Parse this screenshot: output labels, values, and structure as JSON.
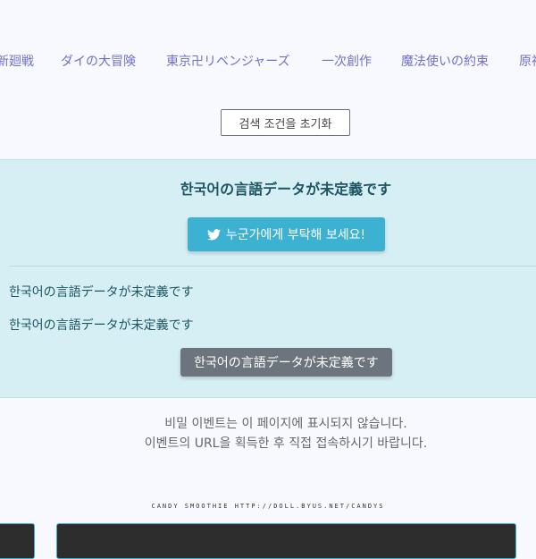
{
  "tags": [
    "新廻戦",
    "ダイの大冒険",
    "東京卍リベンジャーズ",
    "一次創作",
    "魔法使いの約束",
    "原神"
  ],
  "reset_button": {
    "label": "검색 조건을 초기화"
  },
  "alert": {
    "title": "한국어の言語データが未定義です",
    "twitter_button": {
      "icon": "twitter-icon",
      "label": "누군가에게 부탁해 보세요!"
    },
    "lines": [
      "한국어の言語データが未定義です",
      "한국어の言語データが未定義です"
    ],
    "gray_button": {
      "label": "한국어の言語データが未定義です"
    }
  },
  "notice": {
    "line1": "비밀 이벤트는 이 페이지에 표시되지 않습니다.",
    "line2": "이벤트의 URL을 획득한 후 직접 접속하시기 바랍니다."
  },
  "footer": {
    "text": "CANDY SMOOTHIE HTTP://DOLL.BYUS.NET/CANDYS"
  },
  "colors": {
    "link": "#6f6fc8",
    "alert_bg": "#d6eff4",
    "twitter": "#3cb1d1",
    "secondary": "#6c757d"
  }
}
